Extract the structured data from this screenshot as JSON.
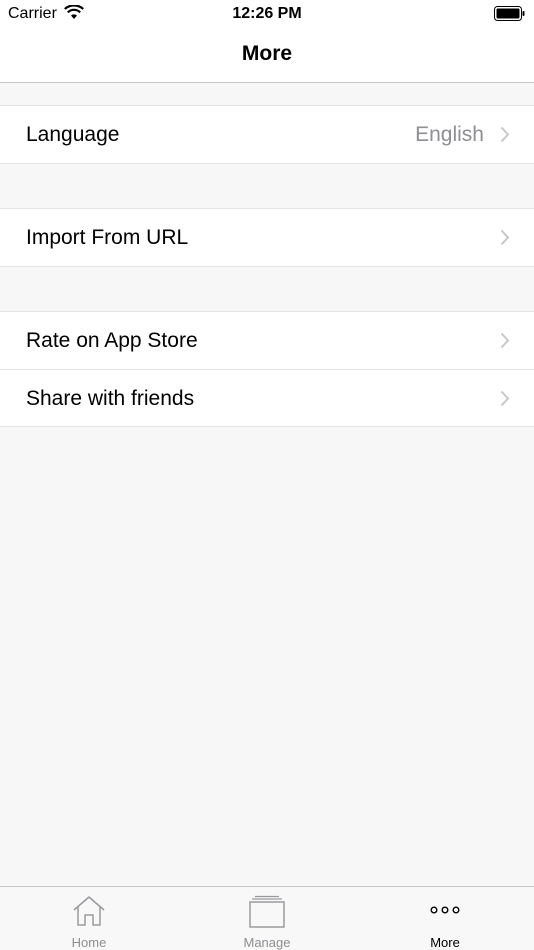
{
  "status_bar": {
    "carrier": "Carrier",
    "time": "12:26 PM"
  },
  "nav": {
    "title": "More"
  },
  "groups": [
    {
      "items": [
        {
          "label": "Language",
          "detail": "English"
        }
      ]
    },
    {
      "items": [
        {
          "label": "Import From URL"
        }
      ]
    },
    {
      "items": [
        {
          "label": "Rate on App Store"
        },
        {
          "label": "Share with friends"
        }
      ]
    }
  ],
  "tabs": [
    {
      "label": "Home",
      "icon": "home-icon",
      "active": false
    },
    {
      "label": "Manage",
      "icon": "folder-icon",
      "active": false
    },
    {
      "label": "More",
      "icon": "more-dots-icon",
      "active": true
    }
  ],
  "colors": {
    "detail_text": "#8e8e93",
    "separator": "#e4e4e6",
    "background": "#f7f7f7"
  }
}
